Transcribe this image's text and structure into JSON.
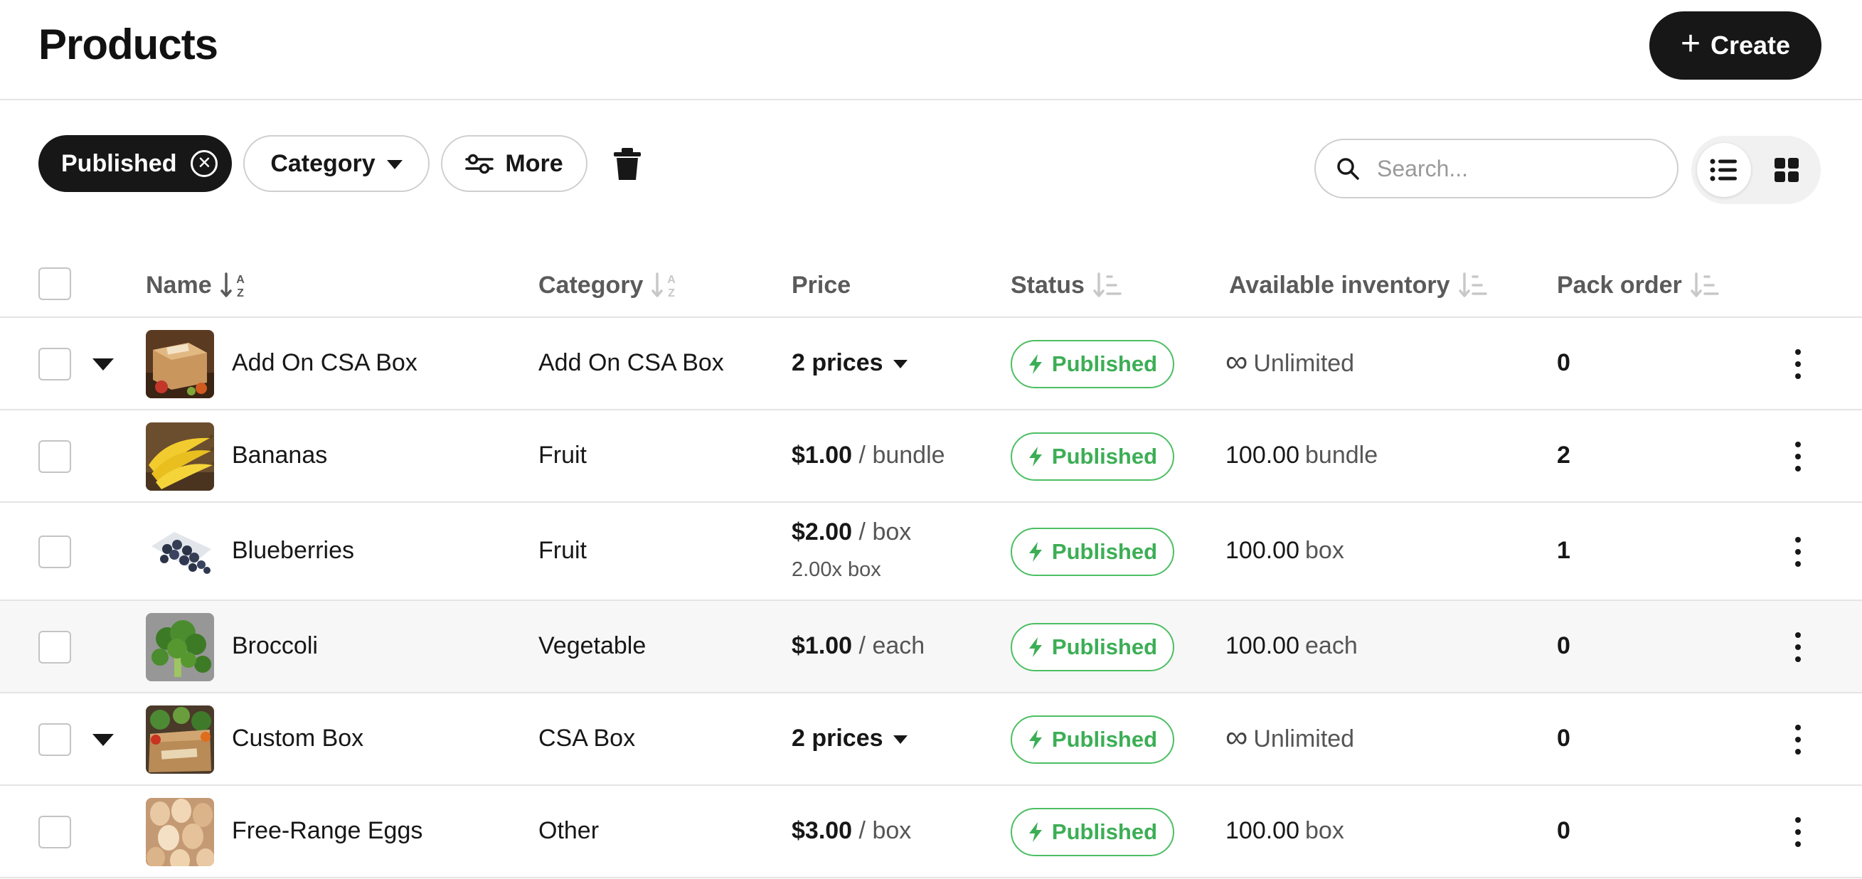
{
  "header": {
    "title": "Products",
    "create_label": "Create"
  },
  "filters": {
    "published_chip": "Published",
    "category_chip": "Category",
    "more_chip": "More"
  },
  "search": {
    "placeholder": "Search..."
  },
  "view": {
    "active": "list"
  },
  "table": {
    "columns": {
      "name": "Name",
      "category": "Category",
      "price": "Price",
      "status": "Status",
      "inventory": "Available inventory",
      "pack_order": "Pack order"
    },
    "rows": [
      {
        "name": "Add On CSA Box",
        "category": "Add On CSA Box",
        "price_summary": "2 prices",
        "status": "Published",
        "inventory_text": "Unlimited",
        "pack_order": "0",
        "expandable": true,
        "thumb": "csa-box"
      },
      {
        "name": "Bananas",
        "category": "Fruit",
        "price_amount": "$1.00",
        "price_unit": "/ bundle",
        "status": "Published",
        "inventory_amount": "100.00",
        "inventory_unit": "bundle",
        "pack_order": "2",
        "thumb": "bananas"
      },
      {
        "name": "Blueberries",
        "category": "Fruit",
        "price_amount": "$2.00",
        "price_unit": "/ box",
        "price_sub": "2.00x box",
        "status": "Published",
        "inventory_amount": "100.00",
        "inventory_unit": "box",
        "pack_order": "1",
        "thumb": "blueberries"
      },
      {
        "name": "Broccoli",
        "category": "Vegetable",
        "price_amount": "$1.00",
        "price_unit": "/ each",
        "status": "Published",
        "inventory_amount": "100.00",
        "inventory_unit": "each",
        "pack_order": "0",
        "thumb": "broccoli"
      },
      {
        "name": "Custom Box",
        "category": "CSA Box",
        "price_summary": "2 prices",
        "status": "Published",
        "inventory_text": "Unlimited",
        "pack_order": "0",
        "expandable": true,
        "thumb": "custom-box"
      },
      {
        "name": "Free-Range Eggs",
        "category": "Other",
        "price_amount": "$3.00",
        "price_unit": "/ box",
        "status": "Published",
        "inventory_amount": "100.00",
        "inventory_unit": "box",
        "pack_order": "0",
        "thumb": "eggs"
      }
    ]
  },
  "colors": {
    "primary": "#171717",
    "published_green": "#3cae55",
    "border": "#e4e4e4"
  }
}
